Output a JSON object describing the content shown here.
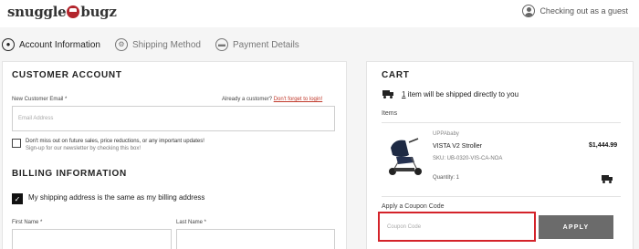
{
  "header": {
    "logo_text_left": "snuggle",
    "logo_text_right": "bugz",
    "guest_text": "Checking out as a guest"
  },
  "steps": [
    {
      "label": "Account Information"
    },
    {
      "label": "Shipping Method"
    },
    {
      "label": "Payment Details"
    }
  ],
  "customer_account": {
    "title": "CUSTOMER ACCOUNT",
    "email_label": "New Customer Email *",
    "already_text": "Already a customer?",
    "login_link": "Don't forget to login!",
    "email_placeholder": "Email Address",
    "newsletter_text": "Don't miss out on future sales, price reductions, or any important updates!",
    "newsletter_sub": "Sign-up for our newsletter by checking this box!"
  },
  "billing": {
    "title": "BILLING INFORMATION",
    "same_address_text": "My shipping address is the same as my billing address",
    "first_name_label": "First Name *",
    "last_name_label": "Last Name *"
  },
  "cart": {
    "title": "CART",
    "ship_count": "1",
    "ship_text": "item will be shipped directly to you",
    "items_label": "Items",
    "item": {
      "brand": "UPPAbaby",
      "name": "VISTA V2 Stroller",
      "sku": "SKU: UB-0320-VIS-CA-NOA",
      "quantity": "Quantity: 1",
      "price": "$1,444.99"
    },
    "coupon_label": "Apply a Coupon Code",
    "coupon_placeholder": "Coupon Code",
    "apply_label": "APPLY"
  }
}
